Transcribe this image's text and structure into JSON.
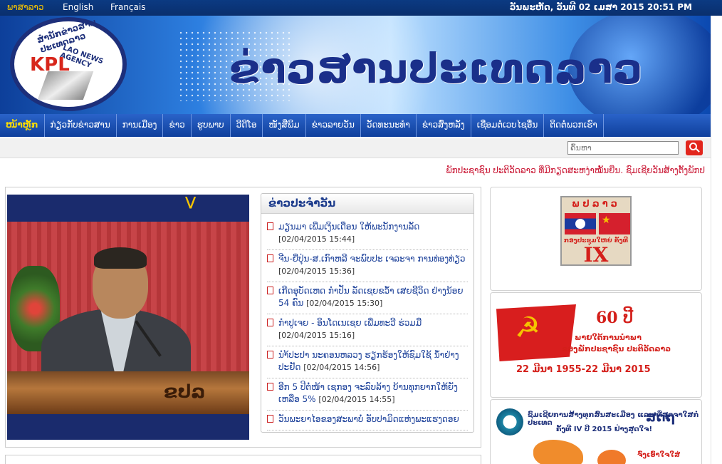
{
  "topbar": {
    "languages": [
      {
        "label": "ພາສາລາວ",
        "active": true
      },
      {
        "label": "English",
        "active": false
      },
      {
        "label": "Français",
        "active": false
      }
    ],
    "date": "ວັນພະຫັດ, ວັນທີ 02 ເມສາ 2015 20:51 PM"
  },
  "banner": {
    "title": "ຂ່າວສານປະເທດລາວ",
    "logo": {
      "abbr": "KPL",
      "arc_text": "ສຳນັກຂ່າວສານປະເທດລາວ",
      "english": "LAO NEWS AGENCY"
    }
  },
  "nav": {
    "items": [
      {
        "label": "ໜ້າຫຼັກ",
        "active": true
      },
      {
        "label": "ກ່ຽວກັບຂ່າວສານ",
        "active": false
      },
      {
        "label": "ການເມືອງ",
        "active": false
      },
      {
        "label": "ຂ່າວ",
        "active": false
      },
      {
        "label": "ຮູບພາບ",
        "active": false
      },
      {
        "label": "ວີດີໂອ",
        "active": false
      },
      {
        "label": "ໜັງສືພິມ",
        "active": false
      },
      {
        "label": "ຂ່າວລາຍວັນ",
        "active": false
      },
      {
        "label": "ວັດທະນະທຳ",
        "active": false
      },
      {
        "label": "ຂ່າວສົ່ງຫລັງ",
        "active": false
      },
      {
        "label": "ເຊື່ອມຕໍ່ເວບໄຊອື່ນ",
        "active": false
      },
      {
        "label": "ຕິດຕໍ່ພວກເຮົາ",
        "active": false
      }
    ]
  },
  "search": {
    "placeholder": "ຄົ້ນຫາ",
    "icon": "search-icon"
  },
  "ticker": "ພັກປະຊາຊົນ ປະຕິວັດລາວ ທີ່ມີກຽດສະຫງ່າໝັ້ນຍືນ.  ຊົມເຊີຍວັນສ້າງຕັ້ງພັກປ",
  "featured": {
    "podium_text": "ຂປລ"
  },
  "daily_news": {
    "heading": "ຂ່າວປະຈຳວັນ",
    "items": [
      {
        "title": "ມຽນມາ ເພີ່ມເງິນເດືອນ ໃຫ້ພະນັກງານລັດ",
        "date": "[02/04/2015 15:44]"
      },
      {
        "title": "ຈີນ-ຍີ່ປຸ່ນ-ສ.ເກົາຫລີ ຈະພົບປະ ເຈລະຈາ ການທ່ອງທ່ຽວ",
        "date": "[02/04/2015 15:36]"
      },
      {
        "title": "ເກີດອຸບັດເຫດ ກຳປັ່ນ ລັດເຊຍຂວ້ຳ ເສຍຊີວິດ ຢ່າງນ້ອຍ 54 ຄົນ",
        "date": "[02/04/2015 15:30]"
      },
      {
        "title": "ກຳປູເຈຍ - ອິນໂດເນເຊຍ ເພີ່ມທະວີ ຮ່ວມມື",
        "date": "[02/04/2015 15:16]"
      },
      {
        "title": "ນຳ້ປະປາ ນະຄອນຫລວງ ຮຽກຮ້ອງໃຫ້ຊົມໃຊ້ ນ້ຳຢ່າງປະຢັດ",
        "date": "[02/04/2015 14:56]"
      },
      {
        "title": "ອີກ 5 ປີຕໍ່ໜ້າ ເຊກອງ ຈະລົບລ້າງ ບ້ານທຸກຍາກໃຫ້ຍັງເຫລືອ 5%",
        "date": "[02/04/2015 14:55]"
      },
      {
        "title": "ວັນພະຍາໄອຂອງສະພາບໍ່ ອັບປາມິດແຫ່ງພະແຮງດອຍ",
        "date": ""
      }
    ]
  },
  "side": {
    "ix": {
      "title": "ພປລາວ",
      "sub": "ກອງປະຊຸມໃຫຍ່ ຄັ້ງທີ",
      "number": "IX"
    },
    "sixty": {
      "number": "60 ປີ",
      "line1": "ພາຍໃຕ້ການນຳພາ",
      "line2": "ຂອງພັກປະຊາຊົນ ປະຕິວັດລາວ",
      "dates": "22 ມີນາ 1955-22 ມີນາ 2015"
    },
    "sddt": {
      "line1": "ຊົມເຊີຍການສ້າງທຸກສົນສະເມືອງ ແລະ ທີ່ສຸດຈາໃສກໍ່ປະເທດ",
      "line2": "ຄັ້ງທີ IV ປີ 2015 ຢ່າງສຸດໃຈ!",
      "mark": "ສດຖ",
      "tip": "ຈົ່ງເອົາໃຈໃສ່"
    }
  }
}
